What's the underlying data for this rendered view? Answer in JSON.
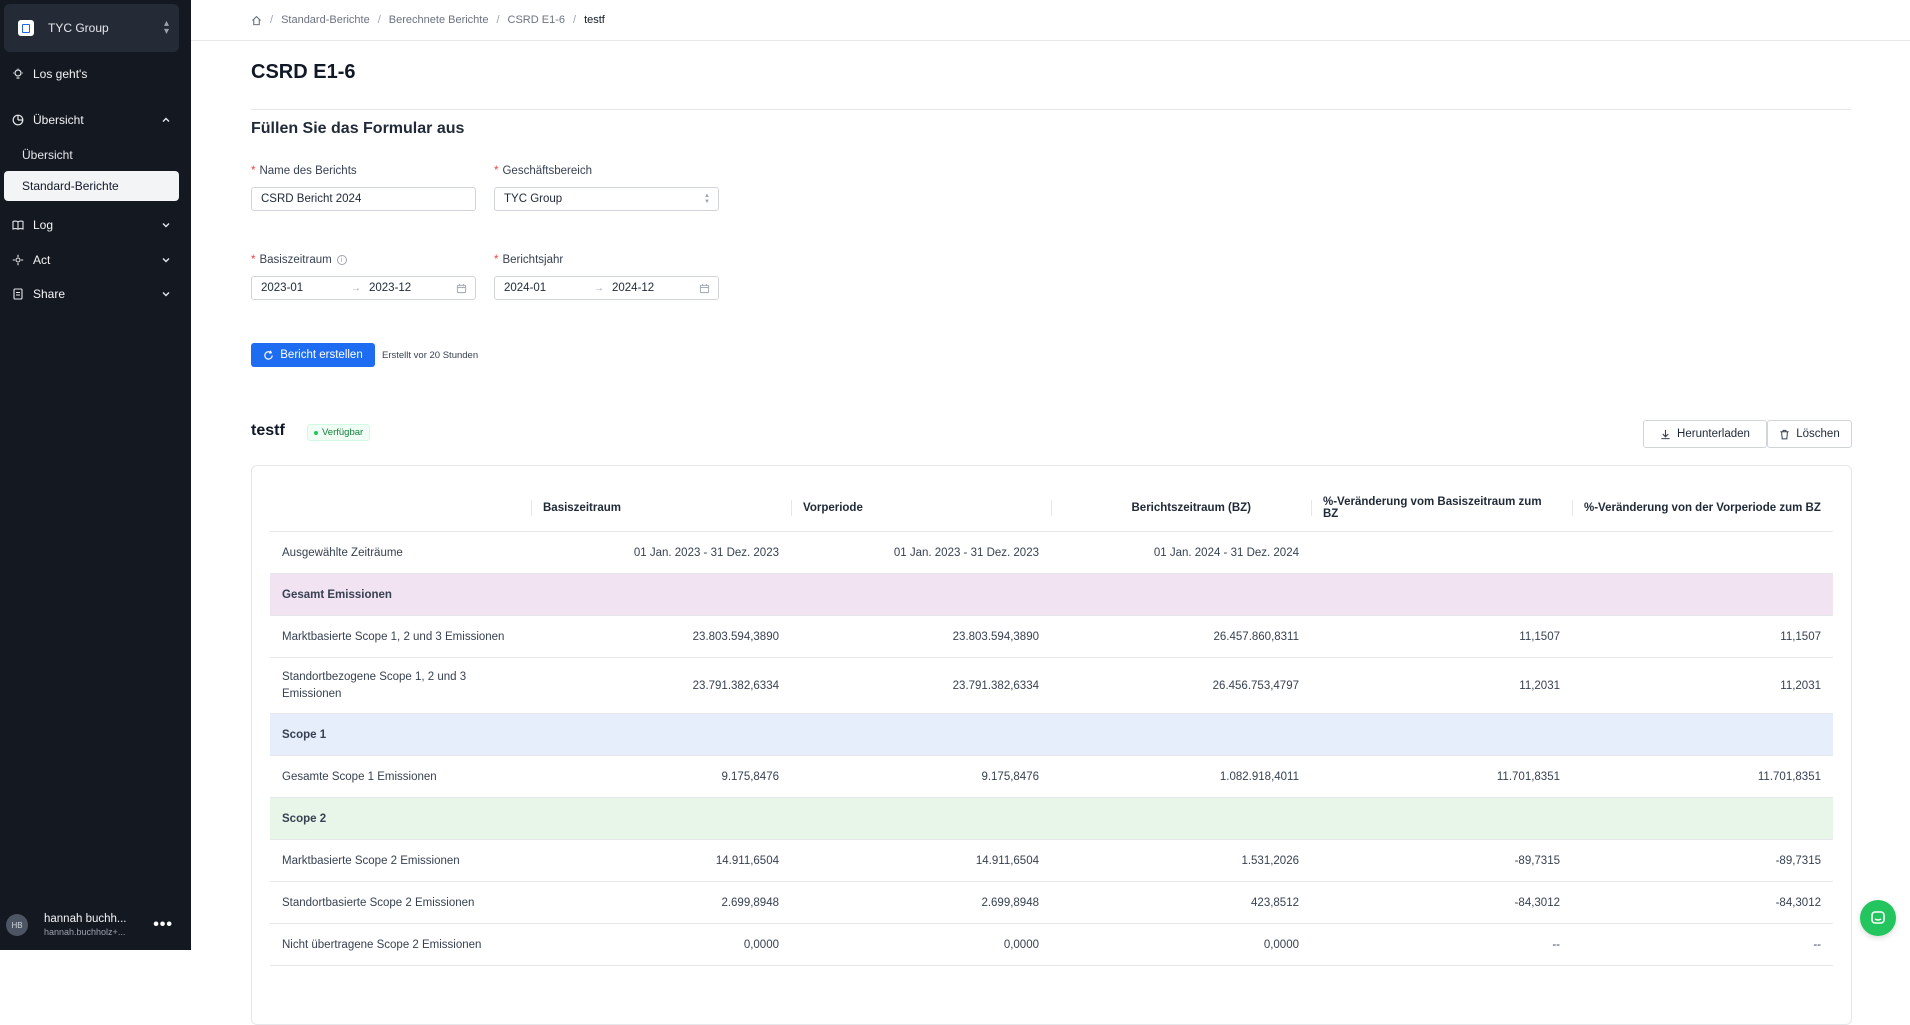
{
  "sidebar": {
    "org_name": "TYC Group",
    "items": [
      {
        "label": "Los geht's"
      },
      {
        "label": "Übersicht"
      },
      {
        "label": "Übersicht"
      },
      {
        "label": "Standard-Berichte"
      },
      {
        "label": "Log"
      },
      {
        "label": "Act"
      },
      {
        "label": "Share"
      }
    ],
    "user": {
      "initials": "HB",
      "name": "hannah buchh...",
      "email": "hannah.buchholz+..."
    }
  },
  "breadcrumb": [
    "Standard-Berichte",
    "Berechnete Berichte",
    "CSRD E1-6",
    "testf"
  ],
  "page": {
    "title": "CSRD E1-6",
    "form_title": "Füllen Sie das Formular aus",
    "fields": {
      "report_name_label": "Name des Berichts",
      "report_name_value": "CSRD Bericht 2024",
      "business_unit_label": "Geschäftsbereich",
      "business_unit_value": "TYC Group",
      "base_period_label": "Basiszeitraum",
      "base_period_start": "2023-01",
      "base_period_end": "2023-12",
      "report_year_label": "Berichtsjahr",
      "report_year_start": "2024-01",
      "report_year_end": "2024-12"
    },
    "create_button": "Bericht erstellen",
    "created_note": "Erstellt vor 20 Stunden"
  },
  "report": {
    "name": "testf",
    "status": "Verfügbar",
    "download_button": "Herunterladen",
    "delete_button": "Löschen"
  },
  "table": {
    "headers": [
      "",
      "Basiszeitraum",
      "Vorperiode",
      "Berichtszeitraum (BZ)",
      "%-Veränderung vom Basiszeitraum zum BZ",
      "%-Veränderung von der Vorperiode zum BZ"
    ],
    "rows": [
      {
        "type": "data",
        "cells": [
          "Ausgewählte Zeiträume",
          "01 Jan. 2023 - 31 Dez. 2023",
          "01 Jan. 2023 - 31 Dez. 2023",
          "01 Jan. 2024 - 31 Dez. 2024",
          "",
          ""
        ]
      },
      {
        "type": "section",
        "color": "#f1e3f1",
        "cells": [
          "Gesamt Emissionen"
        ]
      },
      {
        "type": "data",
        "cells": [
          "Marktbasierte Scope 1, 2 und 3 Emissionen",
          "23.803.594,3890",
          "23.803.594,3890",
          "26.457.860,8311",
          "11,1507",
          "11,1507"
        ]
      },
      {
        "type": "data",
        "cells": [
          "Standortbezogene Scope 1, 2 und 3 Emissionen",
          "23.791.382,6334",
          "23.791.382,6334",
          "26.456.753,4797",
          "11,2031",
          "11,2031"
        ]
      },
      {
        "type": "section",
        "color": "#e6eefb",
        "cells": [
          "Scope 1"
        ]
      },
      {
        "type": "data",
        "cells": [
          "Gesamte Scope 1 Emissionen",
          "9.175,8476",
          "9.175,8476",
          "1.082.918,4011",
          "11.701,8351",
          "11.701,8351"
        ]
      },
      {
        "type": "section",
        "color": "#e8f5e9",
        "cells": [
          "Scope 2"
        ]
      },
      {
        "type": "data",
        "cells": [
          "Marktbasierte Scope 2 Emissionen",
          "14.911,6504",
          "14.911,6504",
          "1.531,2026",
          "-89,7315",
          "-89,7315"
        ]
      },
      {
        "type": "data",
        "cells": [
          "Standortbasierte Scope 2 Emissionen",
          "2.699,8948",
          "2.699,8948",
          "423,8512",
          "-84,3012",
          "-84,3012"
        ]
      },
      {
        "type": "data",
        "cells": [
          "Nicht übertragene Scope 2 Emissionen",
          "0,0000",
          "0,0000",
          "0,0000",
          "--",
          "--"
        ]
      }
    ]
  },
  "colors": {
    "primary": "#1d6cf2",
    "sidebar_bg": "#141821",
    "status_green": "#22c55e"
  }
}
